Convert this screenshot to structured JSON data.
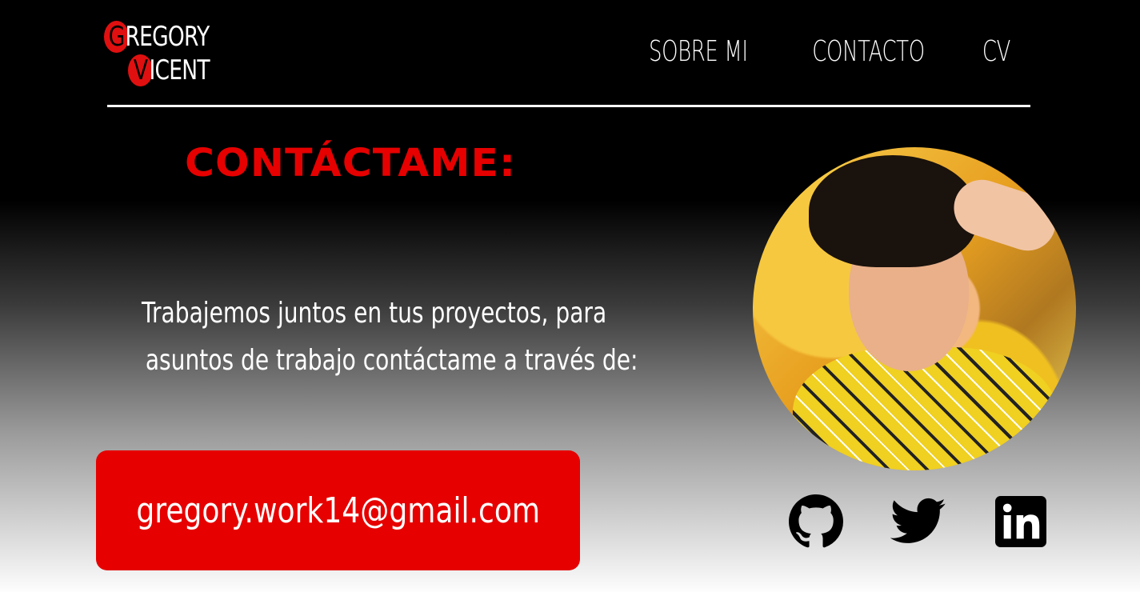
{
  "header": {
    "logo": {
      "line1_initial": "G",
      "line1_rest": "REGORY",
      "line2_initial": "V",
      "line2_rest": "ICENT"
    },
    "nav": [
      "SOBRE MI",
      "CONTACTO",
      "CV"
    ]
  },
  "main": {
    "heading": "CONTÁCTAME:",
    "message_line1": "Trabajemos juntos en tus proyectos, para",
    "message_line2": "asuntos de trabajo contáctame a través de:",
    "email": "gregory.work14@gmail.com"
  },
  "socials": [
    {
      "name": "github-icon"
    },
    {
      "name": "twitter-icon"
    },
    {
      "name": "linkedin-icon"
    }
  ],
  "colors": {
    "accent": "#e60000",
    "background_top": "#000000",
    "background_bottom": "#fdfdfd",
    "text": "#ffffff"
  }
}
